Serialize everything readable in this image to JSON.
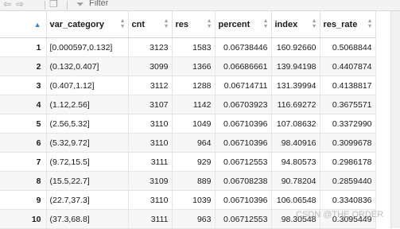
{
  "toolbar": {
    "filter_label": "Filter"
  },
  "table": {
    "columns": [
      "var_category",
      "cnt",
      "res",
      "percent",
      "index",
      "res_rate"
    ],
    "rows": [
      {
        "n": "1",
        "var_category": "[0.000597,0.132]",
        "cnt": "3123",
        "res": "1583",
        "percent": "0.06738446",
        "index": "160.92660",
        "res_rate": "0.5068844"
      },
      {
        "n": "2",
        "var_category": "(0.132,0.407]",
        "cnt": "3099",
        "res": "1366",
        "percent": "0.06686661",
        "index": "139.94198",
        "res_rate": "0.4407874"
      },
      {
        "n": "3",
        "var_category": "(0.407,1.12]",
        "cnt": "3112",
        "res": "1288",
        "percent": "0.06714711",
        "index": "131.39994",
        "res_rate": "0.4138817"
      },
      {
        "n": "4",
        "var_category": "(1.12,2.56]",
        "cnt": "3107",
        "res": "1142",
        "percent": "0.06703923",
        "index": "116.69272",
        "res_rate": "0.3675571"
      },
      {
        "n": "5",
        "var_category": "(2.56,5.32]",
        "cnt": "3110",
        "res": "1049",
        "percent": "0.06710396",
        "index": "107.08632",
        "res_rate": "0.3372990"
      },
      {
        "n": "6",
        "var_category": "(5.32,9.72]",
        "cnt": "3110",
        "res": "964",
        "percent": "0.06710396",
        "index": "98.40916",
        "res_rate": "0.3099678"
      },
      {
        "n": "7",
        "var_category": "(9.72,15.5]",
        "cnt": "3111",
        "res": "929",
        "percent": "0.06712553",
        "index": "94.80573",
        "res_rate": "0.2986178"
      },
      {
        "n": "8",
        "var_category": "(15.5,22.7]",
        "cnt": "3109",
        "res": "889",
        "percent": "0.06708238",
        "index": "90.78204",
        "res_rate": "0.2859440"
      },
      {
        "n": "9",
        "var_category": "(22.7,37.3]",
        "cnt": "3110",
        "res": "1039",
        "percent": "0.06710396",
        "index": "106.06548",
        "res_rate": "0.3340836"
      },
      {
        "n": "10",
        "var_category": "(37.3,68.8]",
        "cnt": "3111",
        "res": "963",
        "percent": "0.06712553",
        "index": "98.30548",
        "res_rate": "0.3095449"
      }
    ]
  },
  "watermark": "CSDN @THE ORDER"
}
